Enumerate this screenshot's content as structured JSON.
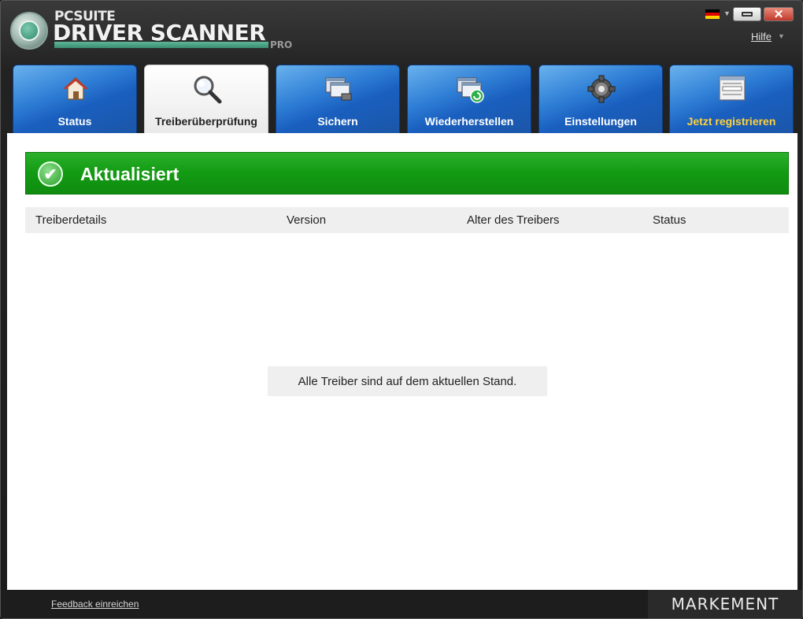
{
  "app": {
    "brand_small": "PCSUITE",
    "brand_big": "DRIVER SCANNER",
    "brand_edition": "PRO",
    "close_glyph": "✕",
    "help_label": "Hilfe",
    "language_flag": "flag-de-icon"
  },
  "tabs": [
    {
      "label": "Status",
      "icon": "home-icon",
      "active": false
    },
    {
      "label": "Treiberüberprüfung",
      "icon": "magnifier-icon",
      "active": true
    },
    {
      "label": "Sichern",
      "icon": "backup-icon",
      "active": false
    },
    {
      "label": "Wiederherstellen",
      "icon": "restore-icon",
      "active": false
    },
    {
      "label": "Einstellungen",
      "icon": "gear-icon",
      "active": false
    },
    {
      "label": "Jetzt registrieren",
      "icon": "register-icon",
      "active": false,
      "color": "#ffd23a"
    }
  ],
  "status_banner": {
    "text": "Aktualisiert",
    "check_glyph": "✔",
    "color": "#139a13"
  },
  "table": {
    "columns": [
      "Treiberdetails",
      "Version",
      "Alter des Treibers",
      "Status"
    ],
    "rows": []
  },
  "empty_message": "Alle Treiber sind auf dem aktuellen Stand.",
  "footer": {
    "feedback_label": "Feedback einreichen",
    "brand": "MARKEMENT"
  }
}
